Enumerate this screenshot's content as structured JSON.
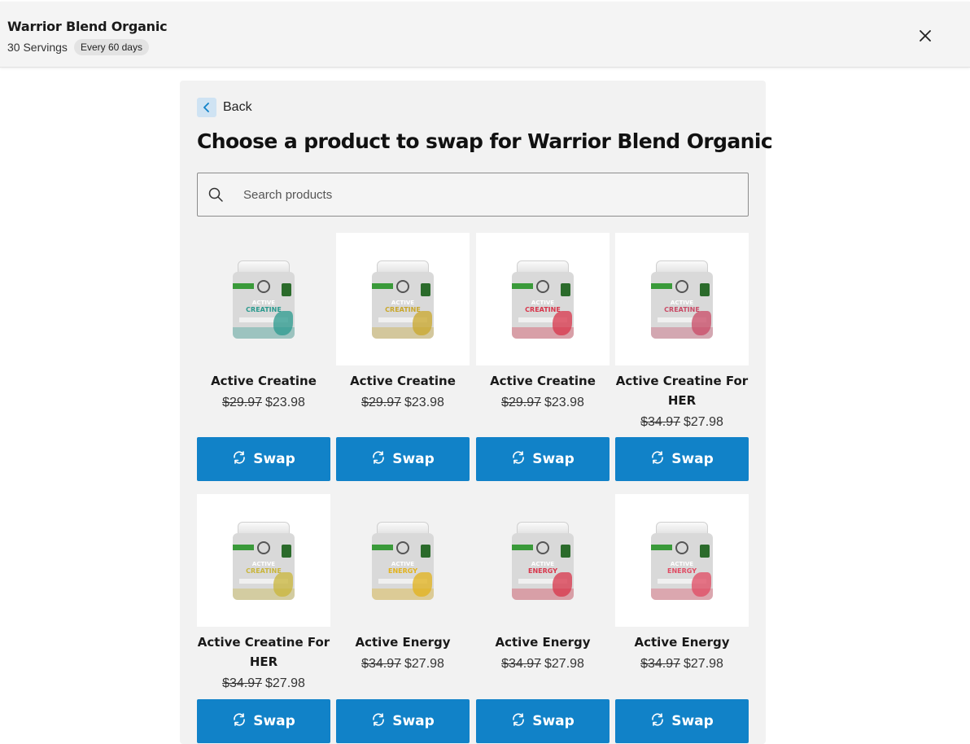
{
  "header": {
    "title": "Warrior Blend Organic",
    "servings": "30 Servings",
    "frequency_badge": "Every 60 days",
    "close_icon": "close-icon"
  },
  "panel": {
    "back_label": "Back",
    "heading": "Choose a product to swap for Warrior Blend Organic",
    "search": {
      "placeholder": "Search products",
      "value": ""
    },
    "swap_label": "Swap",
    "products": [
      {
        "name": "Active Creatine",
        "old_price": "$29.97",
        "price": "$23.98",
        "jar_label": "CREATINE",
        "color": "#2a9a8e"
      },
      {
        "name": "Active Creatine",
        "old_price": "$29.97",
        "price": "$23.98",
        "jar_label": "CREATINE",
        "color": "#c9a72a"
      },
      {
        "name": "Active Creatine",
        "old_price": "$29.97",
        "price": "$23.98",
        "jar_label": "CREATINE",
        "color": "#d8344a"
      },
      {
        "name": "Active Creatine For HER",
        "old_price": "$34.97",
        "price": "$27.98",
        "jar_label": "CREATINE",
        "color": "#c94a66"
      },
      {
        "name": "Active Creatine For HER",
        "old_price": "$34.97",
        "price": "$27.98",
        "jar_label": "CREATINE",
        "color": "#c9b53a"
      },
      {
        "name": "Active Energy",
        "old_price": "$34.97",
        "price": "$27.98",
        "jar_label": "ENERGY",
        "color": "#e2b21a"
      },
      {
        "name": "Active Energy",
        "old_price": "$34.97",
        "price": "$27.98",
        "jar_label": "ENERGY",
        "color": "#d8344a"
      },
      {
        "name": "Active Energy",
        "old_price": "$34.97",
        "price": "$27.98",
        "jar_label": "ENERGY",
        "color": "#e04a62"
      }
    ]
  },
  "colors": {
    "accent": "#1182c8",
    "panel_bg": "#f2f2f2",
    "header_bg": "#f4f4f4"
  }
}
